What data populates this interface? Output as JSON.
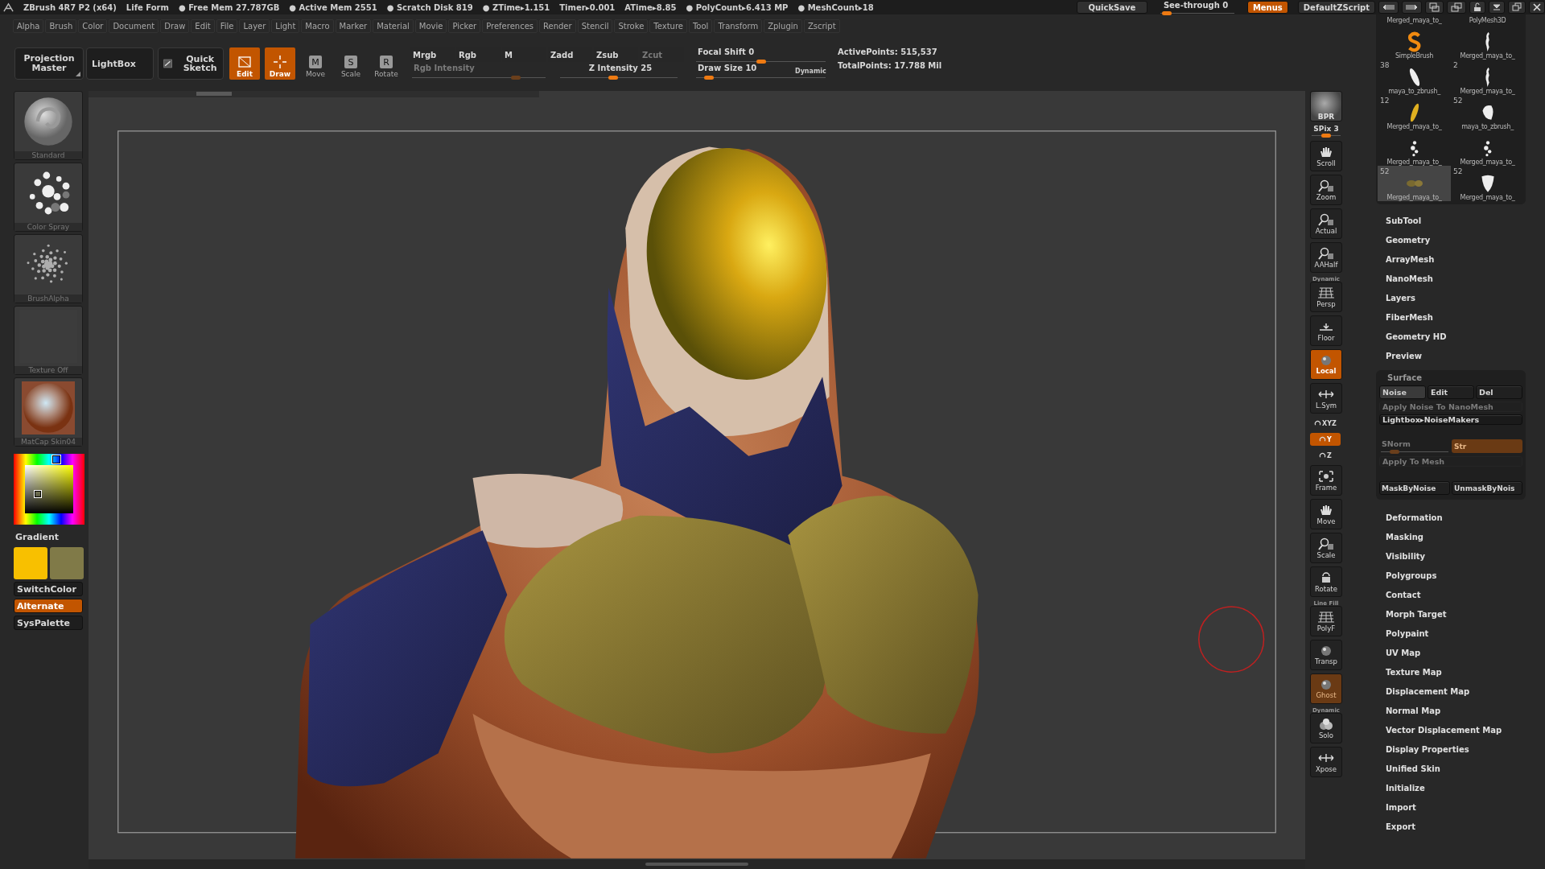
{
  "title_bar": {
    "status": [
      "ZBrush 4R7 P2 (x64)",
      "Life Form",
      "● Free Mem 27.787GB",
      "● Active Mem 2551",
      "● Scratch Disk 819",
      "● ZTime▸1.151",
      "Timer▸0.001",
      "ATime▸8.85",
      "● PolyCount▸6.413 MP",
      "● MeshCount▸18"
    ],
    "quicksave": "QuickSave",
    "see_through": {
      "label": "See-through",
      "value": "0",
      "level": 0.05
    },
    "menus_button": {
      "label": "Menus",
      "on": true
    },
    "script_button": "DefaultZScript"
  },
  "menu_bar": [
    "Alpha",
    "Brush",
    "Color",
    "Document",
    "Draw",
    "Edit",
    "File",
    "Layer",
    "Light",
    "Macro",
    "Marker",
    "Material",
    "Movie",
    "Picker",
    "Preferences",
    "Render",
    "Stencil",
    "Stroke",
    "Texture",
    "Tool",
    "Transform",
    "Zplugin",
    "Zscript"
  ],
  "toolbar": {
    "projection_master": "Projection Master",
    "lightbox": "LightBox",
    "quick_sketch": "Quick Sketch",
    "modes": [
      {
        "label": "Edit",
        "on": true
      },
      {
        "label": "Draw",
        "on": true
      },
      {
        "label": "Move",
        "glyph": "M",
        "on": false
      },
      {
        "label": "Scale",
        "glyph": "S",
        "on": false
      },
      {
        "label": "Rotate",
        "glyph": "R",
        "on": false
      }
    ],
    "channel_buttons": [
      {
        "label": "Mrgb",
        "disabled": false
      },
      {
        "label": "Rgb",
        "disabled": false
      },
      {
        "label": "M",
        "disabled": false
      },
      {
        "label": "Zadd",
        "disabled": false
      },
      {
        "label": "Zsub",
        "disabled": false
      },
      {
        "label": "Zcut",
        "disabled": true
      }
    ],
    "rgb_intensity": {
      "label": "Rgb Intensity",
      "disabled": true,
      "level": 0.78
    },
    "z_intensity": {
      "label": "Z Intensity",
      "value": "25",
      "level": 0.45
    },
    "focal_shift": {
      "label": "Focal Shift",
      "value": "0",
      "level": 0.5
    },
    "draw_size": {
      "label": "Draw Size",
      "value": "10",
      "level": 0.1
    },
    "dynamic": "Dynamic",
    "stats": [
      "ActivePoints: 515,537",
      "TotalPoints: 17.788 Mil"
    ]
  },
  "left_shelf": {
    "thumbnails": [
      {
        "label": "Standard",
        "kind": "brush"
      },
      {
        "label": "Color Spray",
        "kind": "stroke"
      },
      {
        "label": "BrushAlpha",
        "kind": "alpha"
      },
      {
        "label": "Texture Off",
        "kind": "texture"
      },
      {
        "label": "MatCap Skin04",
        "kind": "material"
      }
    ],
    "gradient_label": "Gradient",
    "swatches": [
      {
        "color": "#f8c000"
      },
      {
        "color": "#807a48"
      }
    ],
    "buttons": [
      {
        "label": "SwitchColor",
        "on": false
      },
      {
        "label": "Alternate",
        "on": true
      },
      {
        "label": "SysPalette",
        "on": false
      }
    ]
  },
  "right_shelf": {
    "items": [
      {
        "label": "BPR",
        "kind": "thumb",
        "on": false,
        "disabled": false
      },
      {
        "label": "SPix",
        "value": "3",
        "kind": "slider",
        "level": 0.5,
        "on": false,
        "disabled": false
      },
      {
        "label": "Scroll",
        "kind": "button",
        "on": false,
        "disabled": false
      },
      {
        "label": "Zoom",
        "kind": "button",
        "on": false,
        "disabled": false
      },
      {
        "label": "Actual",
        "kind": "button",
        "on": false,
        "disabled": false
      },
      {
        "label": "AAHalf",
        "kind": "button",
        "on": false,
        "disabled": false
      },
      {
        "label": "Persp",
        "caption": "Dynamic",
        "kind": "button",
        "on": false,
        "disabled": false
      },
      {
        "label": "Floor",
        "kind": "button",
        "on": false,
        "disabled": false
      },
      {
        "label": "Local",
        "kind": "button",
        "on": true,
        "disabled": false
      },
      {
        "label": "L.Sym",
        "kind": "button",
        "on": false,
        "disabled": false
      },
      {
        "label": "XYZ",
        "kind": "mini",
        "on": false,
        "disabled": false
      },
      {
        "label": "Y",
        "kind": "mini",
        "on": true,
        "disabled": false
      },
      {
        "label": "Z",
        "kind": "mini",
        "on": false,
        "disabled": false
      },
      {
        "label": "Frame",
        "kind": "button",
        "on": false,
        "disabled": false
      },
      {
        "label": "Move",
        "kind": "button",
        "on": false,
        "disabled": false
      },
      {
        "label": "Scale",
        "kind": "button",
        "on": false,
        "disabled": false
      },
      {
        "label": "Rotate",
        "kind": "button",
        "on": false,
        "disabled": false
      },
      {
        "label": "PolyF",
        "caption": "Line Fill",
        "kind": "button",
        "on": false,
        "disabled": false
      },
      {
        "label": "Transp",
        "kind": "button",
        "on": false,
        "disabled": false
      },
      {
        "label": "Ghost",
        "kind": "button",
        "on": true,
        "disabled": true
      },
      {
        "label": "Solo",
        "caption": "Dynamic",
        "kind": "button",
        "on": false,
        "disabled": false
      },
      {
        "label": "Xpose",
        "kind": "button",
        "on": false,
        "disabled": false
      }
    ]
  },
  "right_panel": {
    "thumbnails": [
      {
        "label": "Merged_maya_to_",
        "kind": "partial",
        "selected": false
      },
      {
        "label": "PolyMesh3D",
        "kind": "partial",
        "selected": false
      },
      {
        "label": "SimpleBrush",
        "kind": "full",
        "selected": false
      },
      {
        "label": "Merged_maya_to_",
        "kind": "full",
        "selected": false
      },
      {
        "label": "maya_to_zbrush_",
        "count": "38",
        "kind": "full",
        "selected": false
      },
      {
        "label": "Merged_maya_to_",
        "count": "2",
        "kind": "full",
        "selected": false
      },
      {
        "label": "Merged_maya_to_",
        "count": "12",
        "kind": "full",
        "selected": false
      },
      {
        "label": "maya_to_zbrush_",
        "count": "52",
        "kind": "full",
        "selected": false
      },
      {
        "label": "Merged_maya_to_",
        "kind": "full",
        "selected": false
      },
      {
        "label": "Merged_maya_to_",
        "kind": "full",
        "selected": false
      },
      {
        "label": "Merged_maya_to_",
        "count": "52",
        "kind": "full",
        "selected": true
      },
      {
        "label": "Merged_maya_to_",
        "count": "52",
        "kind": "full",
        "selected": false
      }
    ],
    "palettes_before": [
      "SubTool",
      "Geometry",
      "ArrayMesh",
      "NanoMesh",
      "Layers",
      "FiberMesh",
      "Geometry HD",
      "Preview"
    ],
    "surface": {
      "title": "Surface",
      "tabs": [
        {
          "label": "Noise",
          "selected": true
        },
        {
          "label": "Edit",
          "selected": false
        },
        {
          "label": "Del",
          "selected": false
        }
      ],
      "apply_nano": {
        "label": "Apply Noise To NanoMesh",
        "disabled": true
      },
      "lightbox": "Lightbox▸NoiseMakers",
      "snorm": {
        "label": "SNorm",
        "level": 0.2,
        "disabled": true
      },
      "str": {
        "label": "Str",
        "disabled": true
      },
      "apply_mesh": {
        "label": "Apply To Mesh",
        "disabled": true
      },
      "mask_buttons": [
        "MaskByNoise",
        "UnmaskByNois"
      ]
    },
    "palettes_after": [
      "Deformation",
      "Masking",
      "Visibility",
      "Polygroups",
      "Contact",
      "Morph Target",
      "Polypaint",
      "UV Map",
      "Texture Map",
      "Displacement Map",
      "Normal Map",
      "Vector Displacement Map",
      "Display Properties",
      "Unified Skin",
      "Initialize",
      "Import",
      "Export"
    ]
  }
}
